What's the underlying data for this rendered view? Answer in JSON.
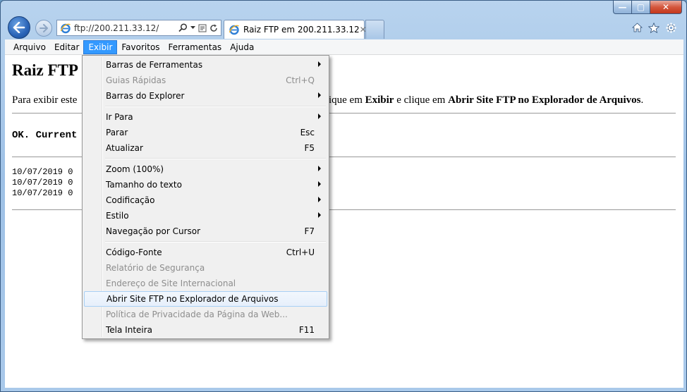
{
  "window": {
    "controls": {
      "minimize": "—",
      "maximize": "▢",
      "close": "✕"
    }
  },
  "address": {
    "value": "ftp://200.211.33.12/"
  },
  "tab": {
    "title": "Raiz FTP em 200.211.33.12",
    "close": "✕"
  },
  "menubar": {
    "items": [
      {
        "label": "Arquivo",
        "name": "menu-arquivo"
      },
      {
        "label": "Editar",
        "name": "menu-editar"
      },
      {
        "label": "Exibir",
        "name": "menu-exibir",
        "active": true
      },
      {
        "label": "Favoritos",
        "name": "menu-favoritos"
      },
      {
        "label": "Ferramentas",
        "name": "menu-ferramentas"
      },
      {
        "label": "Ajuda",
        "name": "menu-ajuda"
      }
    ]
  },
  "page": {
    "title": "Raiz FTP",
    "instr_pre": "Para exibir este",
    "instr_mid1": "ique em ",
    "instr_b1": "Exibir",
    "instr_mid2": " e clique em ",
    "instr_b2": "Abrir Site FTP no Explorador de Arquivos",
    "instr_end": ".",
    "status": "OK. Current",
    "listing": [
      "10/07/2019 0",
      "10/07/2019 0",
      "10/07/2019 0"
    ]
  },
  "dropdown": {
    "items": [
      {
        "label": "Barras de Ferramentas",
        "submenu": true,
        "name": "menu-barras-ferramentas"
      },
      {
        "label": "Guias Rápidas",
        "shortcut": "Ctrl+Q",
        "disabled": true,
        "name": "menu-guias-rapidas"
      },
      {
        "label": "Barras do Explorer",
        "submenu": true,
        "name": "menu-barras-explorer"
      },
      {
        "sep": true
      },
      {
        "label": "Ir Para",
        "submenu": true,
        "name": "menu-ir-para"
      },
      {
        "label": "Parar",
        "shortcut": "Esc",
        "name": "menu-parar"
      },
      {
        "label": "Atualizar",
        "shortcut": "F5",
        "name": "menu-atualizar"
      },
      {
        "sep": true
      },
      {
        "label": "Zoom (100%)",
        "submenu": true,
        "name": "menu-zoom"
      },
      {
        "label": "Tamanho do texto",
        "submenu": true,
        "name": "menu-tamanho-texto"
      },
      {
        "label": "Codificação",
        "submenu": true,
        "name": "menu-codificacao"
      },
      {
        "label": "Estilo",
        "submenu": true,
        "name": "menu-estilo"
      },
      {
        "label": "Navegação por Cursor",
        "shortcut": "F7",
        "name": "menu-navegacao-cursor"
      },
      {
        "sep": true
      },
      {
        "label": "Código-Fonte",
        "shortcut": "Ctrl+U",
        "name": "menu-codigo-fonte"
      },
      {
        "label": "Relatório de Segurança",
        "disabled": true,
        "name": "menu-relatorio-seguranca"
      },
      {
        "label": "Endereço de Site Internacional",
        "disabled": true,
        "name": "menu-endereco-internacional"
      },
      {
        "label": "Abrir Site FTP no Explorador de Arquivos",
        "hover": true,
        "name": "menu-abrir-ftp"
      },
      {
        "label": "Política de Privacidade da Página da Web...",
        "disabled": true,
        "name": "menu-politica-privacidade"
      },
      {
        "label": "Tela Inteira",
        "shortcut": "F11",
        "name": "menu-tela-inteira"
      }
    ]
  }
}
